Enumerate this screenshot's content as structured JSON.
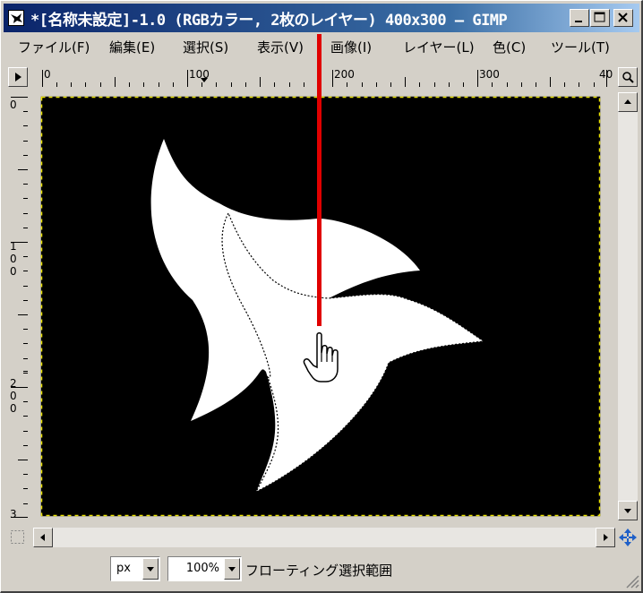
{
  "window": {
    "title": "*[名称未設定]-1.0 (RGBカラー, 2枚のレイヤー) 400x300 – GIMP",
    "caption_buttons": [
      "minimize-icon",
      "maximize-icon",
      "close-icon"
    ]
  },
  "menu": {
    "items": [
      {
        "label": "ファイル(F)"
      },
      {
        "label": "編集(E)"
      },
      {
        "label": "選択(S)"
      },
      {
        "label": "表示(V)"
      },
      {
        "label": "画像(I)"
      },
      {
        "label": "レイヤー(L)"
      },
      {
        "label": "色(C)"
      },
      {
        "label": "ツール(T)"
      }
    ]
  },
  "rulers": {
    "horizontal_labels": [
      "0",
      "100",
      "200",
      "300",
      "40"
    ],
    "vertical_labels": [
      "0",
      "100",
      "200",
      "3"
    ]
  },
  "canvas": {
    "background_color": "#000000",
    "shape_color": "#ffffff",
    "selection": "floating selection (marching ants)"
  },
  "status": {
    "unit": "px",
    "zoom": "100%",
    "message": "フローティング選択範囲"
  },
  "annotation": {
    "pointer_line_color": "#e00000",
    "cursor_icon": "hand-pointer-icon"
  }
}
